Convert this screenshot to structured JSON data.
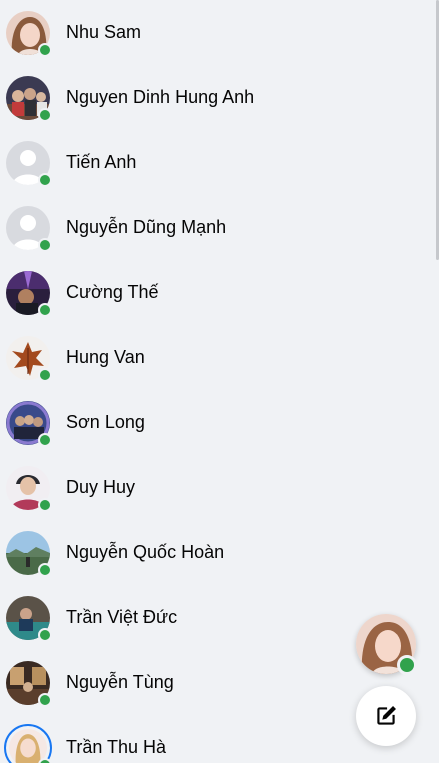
{
  "contacts": [
    {
      "name": "Nhu Sam",
      "online": true,
      "avatar_icon": "person-photo"
    },
    {
      "name": "Nguyen Dinh Hung Anh",
      "online": true,
      "avatar_icon": "group-photo"
    },
    {
      "name": "Tiến Anh",
      "online": true,
      "avatar_icon": "default-person"
    },
    {
      "name": "Nguyễn Dũng Mạnh",
      "online": true,
      "avatar_icon": "default-person"
    },
    {
      "name": "Cường Thế",
      "online": true,
      "avatar_icon": "night-photo"
    },
    {
      "name": "Hung Van",
      "online": true,
      "avatar_icon": "autumn-leaf"
    },
    {
      "name": "Sơn Long",
      "online": true,
      "avatar_icon": "group-photo"
    },
    {
      "name": "Duy Huy",
      "online": true,
      "avatar_icon": "person-photo"
    },
    {
      "name": "Nguyễn Quốc Hoàn",
      "online": true,
      "avatar_icon": "landscape-photo"
    },
    {
      "name": "Trần Việt Đức",
      "online": true,
      "avatar_icon": "pool-photo"
    },
    {
      "name": "Nguyễn Tùng",
      "online": true,
      "avatar_icon": "room-photo"
    },
    {
      "name": "Trần Thu Hà",
      "online": true,
      "avatar_icon": "person-photo"
    }
  ],
  "colors": {
    "background": "#f0f2f5",
    "online": "#31a24c",
    "story_ring": "#1877f2",
    "text": "#050505"
  },
  "floating": {
    "chat_head_online": true,
    "compose_icon": "compose-icon"
  }
}
